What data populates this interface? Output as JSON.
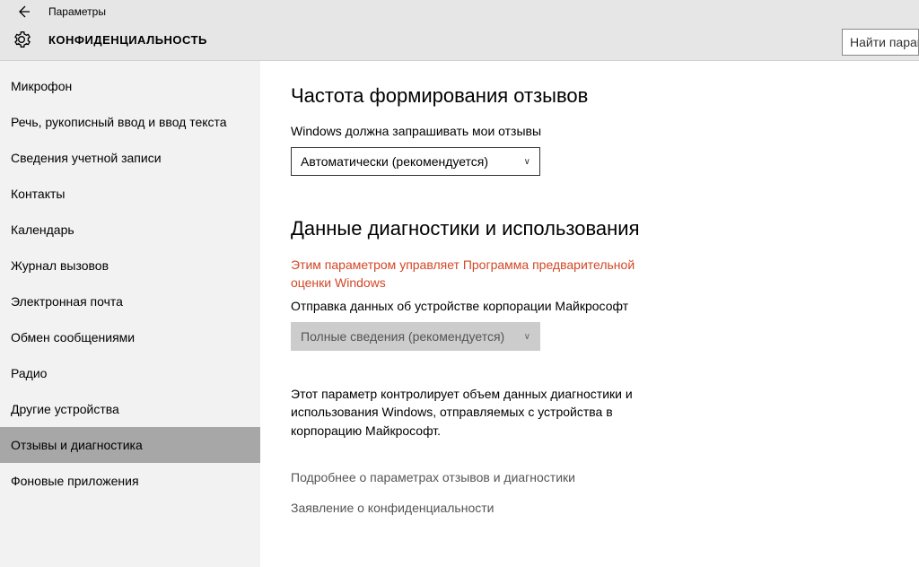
{
  "titlebar": {
    "app_title": "Параметры"
  },
  "header": {
    "section": "КОНФИДЕНЦИАЛЬНОСТЬ"
  },
  "search": {
    "placeholder": "Найти параметр"
  },
  "sidebar": {
    "items": [
      {
        "label": "Микрофон",
        "selected": false
      },
      {
        "label": "Речь, рукописный ввод и ввод текста",
        "selected": false
      },
      {
        "label": "Сведения учетной записи",
        "selected": false
      },
      {
        "label": "Контакты",
        "selected": false
      },
      {
        "label": "Календарь",
        "selected": false
      },
      {
        "label": "Журнал вызовов",
        "selected": false
      },
      {
        "label": "Электронная почта",
        "selected": false
      },
      {
        "label": "Обмен сообщениями",
        "selected": false
      },
      {
        "label": "Радио",
        "selected": false
      },
      {
        "label": "Другие устройства",
        "selected": false
      },
      {
        "label": "Отзывы и диагностика",
        "selected": true
      },
      {
        "label": "Фоновые приложения",
        "selected": false
      }
    ]
  },
  "main": {
    "section1": {
      "heading": "Частота формирования отзывов",
      "label": "Windows должна запрашивать мои отзывы",
      "combo_value": "Автоматически (рекомендуется)"
    },
    "section2": {
      "heading": "Данные диагностики и использования",
      "warning": "Этим параметром управляет Программа предварительной оценки Windows",
      "label": "Отправка данных об устройстве корпорации Майкрософт",
      "combo_value": "Полные сведения (рекомендуется)",
      "description": "Этот параметр контролирует объем данных диагностики и использования Windows, отправляемых с устройства в корпорацию Майкрософт."
    },
    "links": {
      "l1": "Подробнее о параметрах отзывов и диагностики",
      "l2": "Заявление о конфиденциальности"
    }
  }
}
